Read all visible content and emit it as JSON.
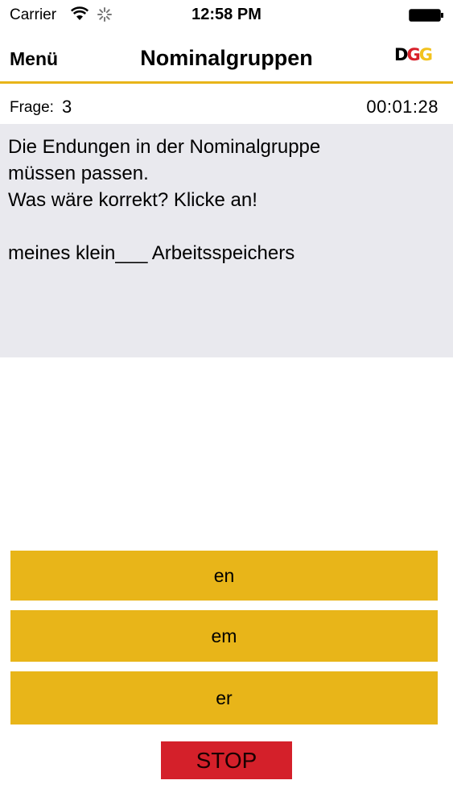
{
  "status_bar": {
    "carrier": "Carrier",
    "time": "12:58 PM"
  },
  "nav": {
    "menu_label": "Menü",
    "title": "Nominalgruppen",
    "logo_letters": [
      "D",
      "G",
      "G"
    ]
  },
  "info": {
    "frage_label": "Frage:",
    "frage_number": "3",
    "timer": "00:01:28"
  },
  "question": {
    "text": "Die Endungen in der Nominalgruppe\nmüssen passen.\nWas wäre korrekt? Klicke an!\n\nmeines klein___ Arbeitsspeichers"
  },
  "answers": [
    {
      "label": "en"
    },
    {
      "label": "em"
    },
    {
      "label": "er"
    }
  ],
  "stop_label": "STOP",
  "colors": {
    "accent_yellow": "#e8b519",
    "stop_red": "#d4202a",
    "panel_gray": "#e9e9ee"
  }
}
